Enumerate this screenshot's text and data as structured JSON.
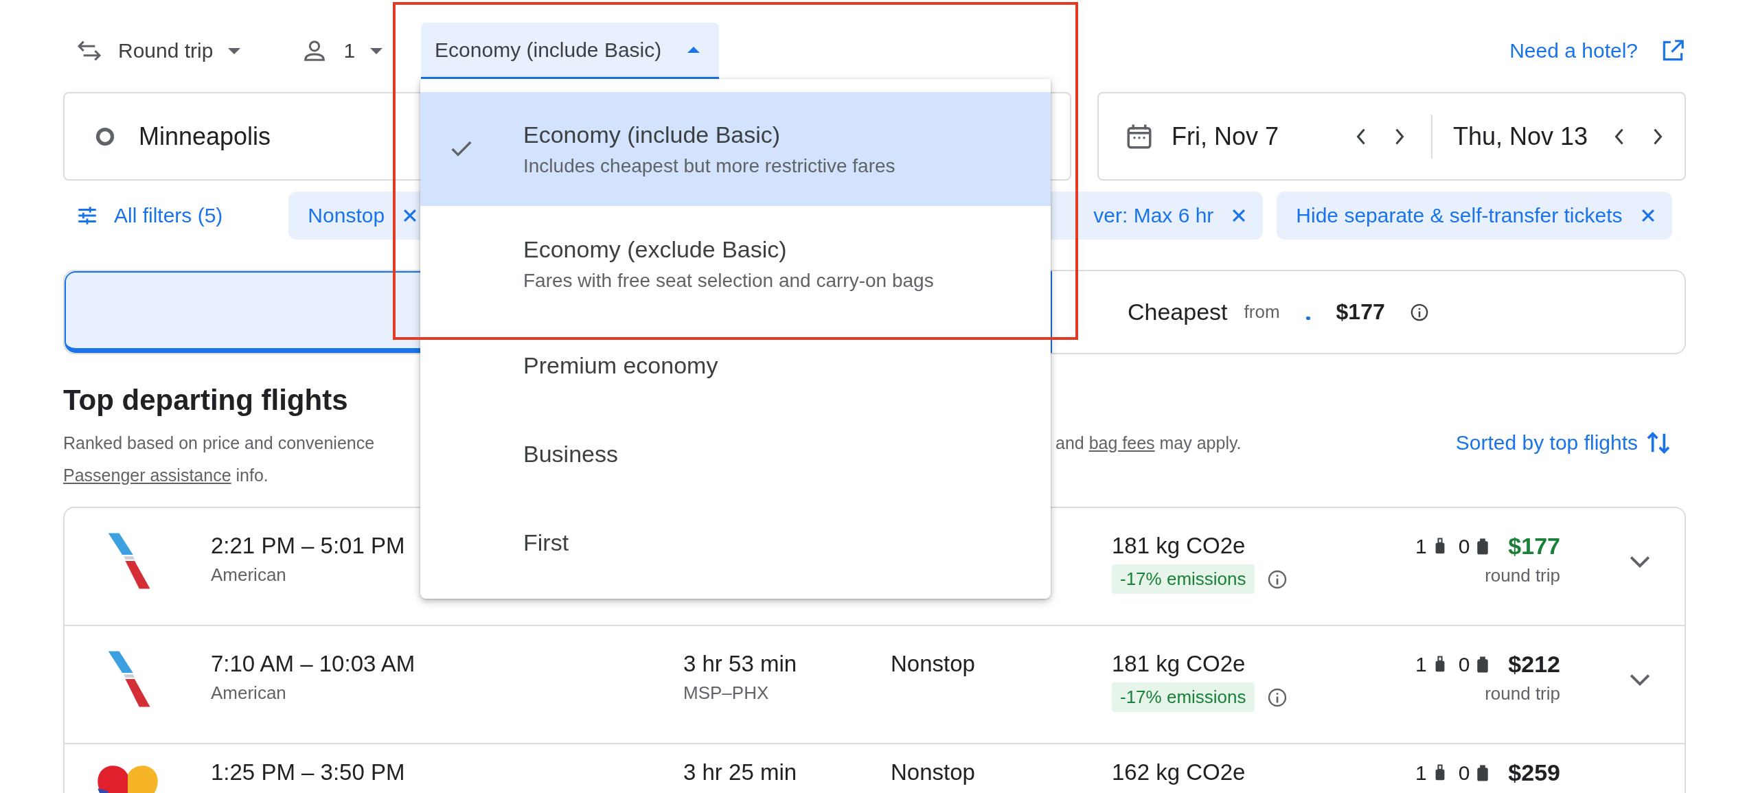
{
  "trip_type": {
    "label": "Round trip"
  },
  "passengers": {
    "count": "1"
  },
  "cabin_class": {
    "label": "Economy (include Basic)",
    "expanded": true
  },
  "hotel_link": {
    "label": "Need a hotel?"
  },
  "origin": {
    "value": "Minneapolis"
  },
  "dates": {
    "depart": "Fri, Nov 7",
    "return": "Thu, Nov 13"
  },
  "filters": {
    "all_filters": "All filters (5)",
    "chips": [
      {
        "label": "Nonstop"
      },
      {
        "label": "ver: Max 6 hr"
      },
      {
        "label": "Hide separate & self-transfer tickets"
      }
    ]
  },
  "tabs": [
    {
      "selected": true
    },
    {
      "label": "Cheapest",
      "from": "from",
      "price": "$177",
      "selected": false
    }
  ],
  "section": {
    "title": "Top departing flights",
    "subtitle_start": "Ranked based on price and convenience",
    "subtitle_end": {
      "prefix": "and",
      "link": "bag fees",
      "suffix": "may apply."
    },
    "assistance": {
      "link": "Passenger assistance",
      "suffix": "info."
    },
    "sort": "Sorted by top flights"
  },
  "flights": [
    {
      "kind": "american",
      "times": "2:21 PM – 5:01 PM",
      "airline": "American",
      "co2": "181 kg CO2e",
      "emissions": "-17% emissions",
      "carry_on": "1",
      "checked": "0",
      "price": "$177",
      "highlight": true,
      "price_note": "round trip"
    },
    {
      "kind": "american",
      "times": "7:10 AM – 10:03 AM",
      "airline": "American",
      "duration": "3 hr 53 min",
      "route": "MSP–PHX",
      "stops": "Nonstop",
      "co2": "181 kg CO2e",
      "emissions": "-17% emissions",
      "carry_on": "1",
      "checked": "0",
      "price": "$212",
      "highlight": false,
      "price_note": "round trip"
    },
    {
      "kind": "southwest",
      "times": "1:25 PM – 3:50 PM",
      "duration": "3 hr 25 min",
      "stops": "Nonstop",
      "co2": "162 kg CO2e",
      "carry_on": "1",
      "checked": "0",
      "price": "$259",
      "highlight": false
    }
  ],
  "menu": {
    "options": [
      {
        "label": "Economy (include Basic)",
        "description": "Includes cheapest but more restrictive fares",
        "selected": true
      },
      {
        "label": "Economy (exclude Basic)",
        "description": "Fares with free seat selection and carry-on bags",
        "selected": false
      },
      {
        "label": "Premium economy",
        "selected": false
      },
      {
        "label": "Business",
        "selected": false
      },
      {
        "label": "First",
        "selected": false
      }
    ]
  }
}
